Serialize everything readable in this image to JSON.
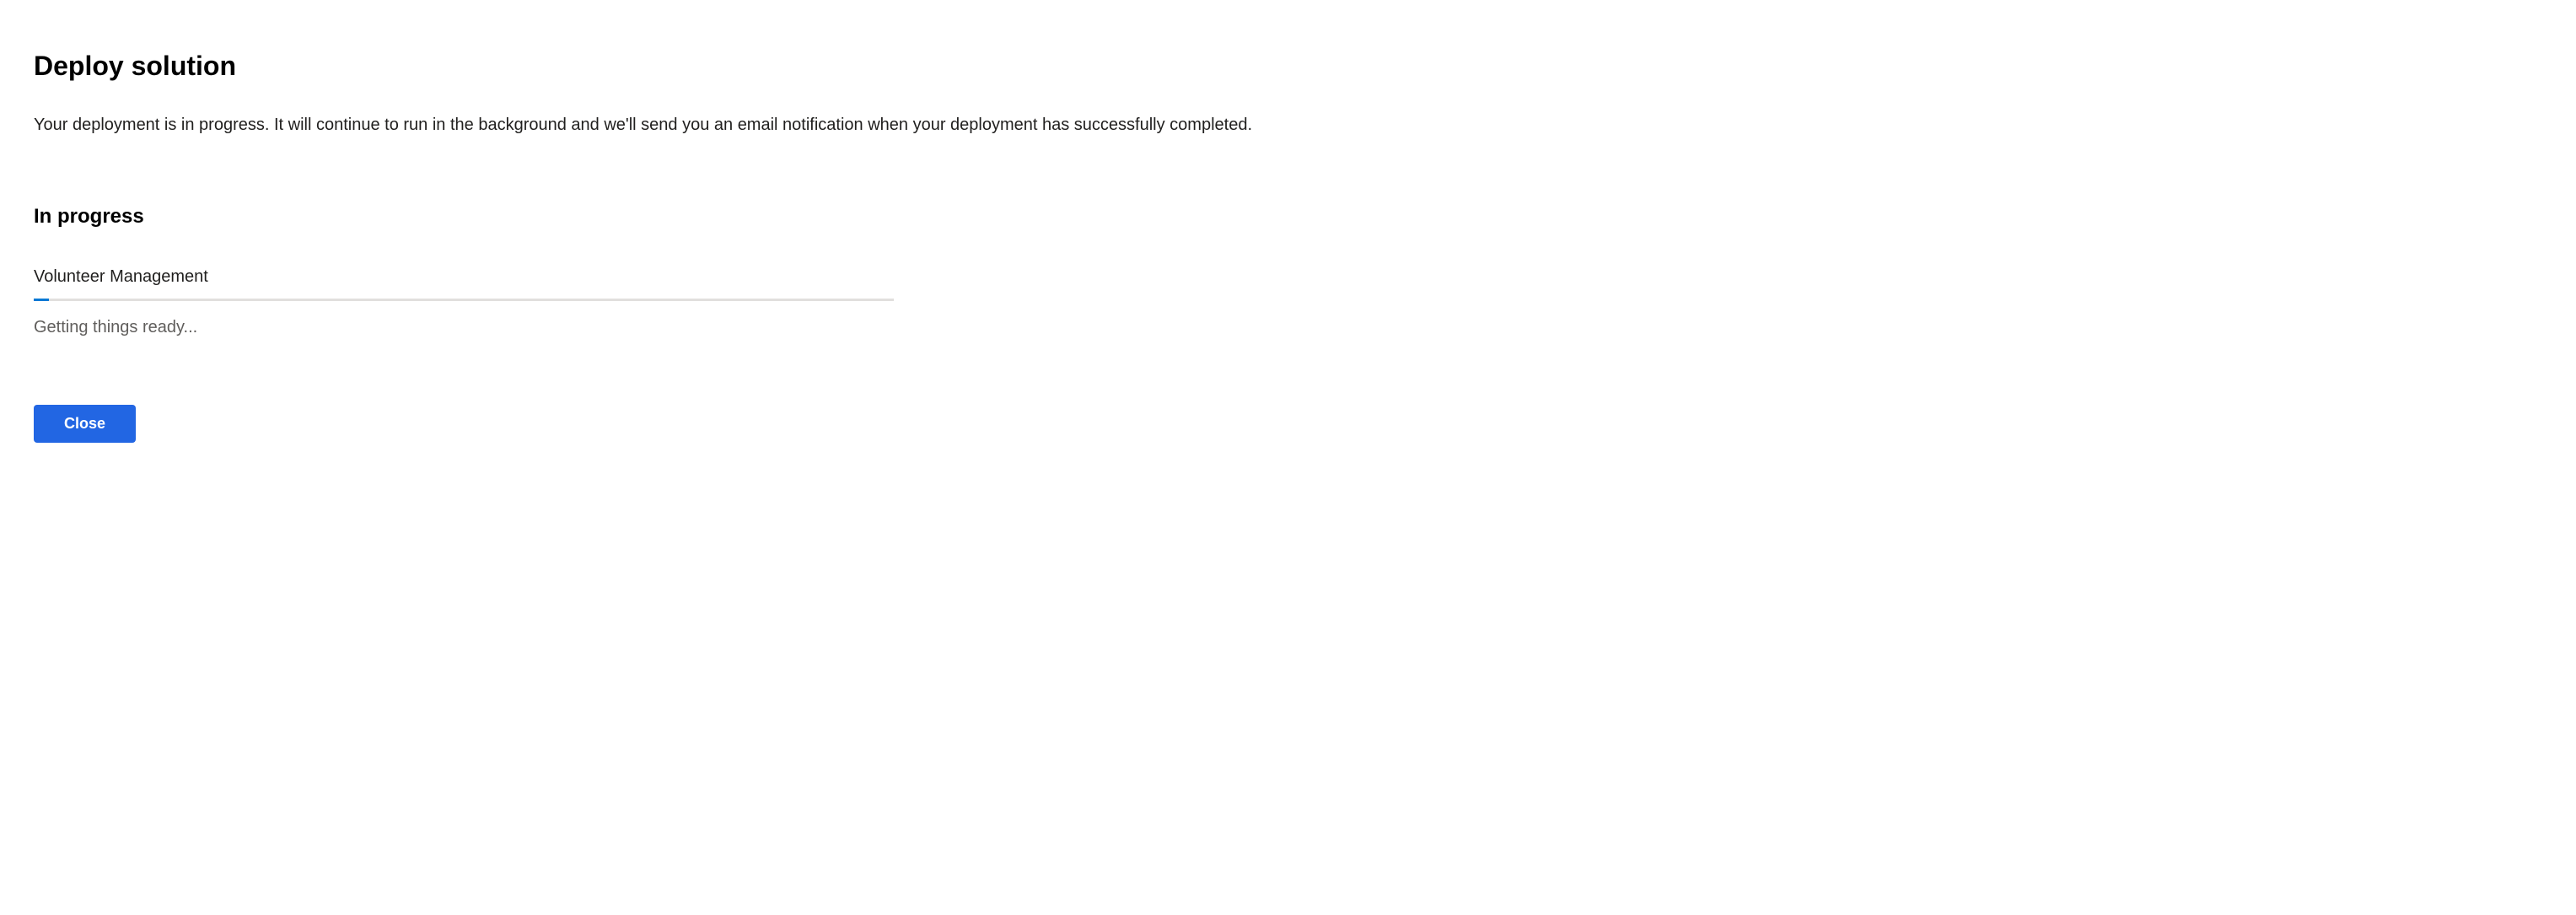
{
  "header": {
    "title": "Deploy solution",
    "description": "Your deployment is in progress. It will continue to run in the background and we'll send you an email notification when your deployment has successfully completed."
  },
  "progress": {
    "section_label": "In progress",
    "item_name": "Volunteer Management",
    "status_text": "Getting things ready...",
    "percent": 2
  },
  "actions": {
    "close_label": "Close"
  },
  "colors": {
    "accent": "#0078d4",
    "button_primary": "#2266e3"
  }
}
